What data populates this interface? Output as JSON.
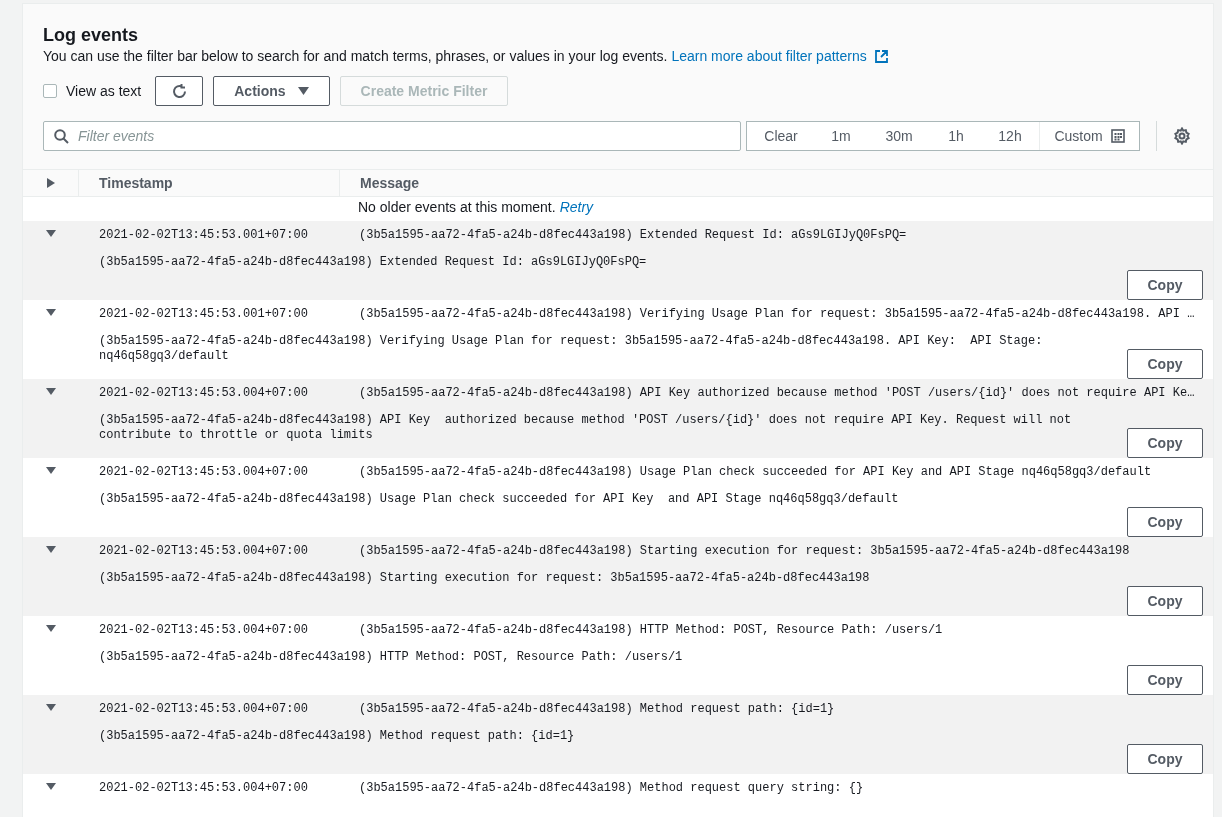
{
  "header": {
    "title": "Log events",
    "description": "You can use the filter bar below to search for and match terms, phrases, or values in your log events.",
    "learn_more_link": "Learn more about filter patterns"
  },
  "toolbar": {
    "view_as_text": {
      "label": "View as text",
      "checked": false
    },
    "actions_button": "Actions",
    "create_metric_filter_button": {
      "label": "Create Metric Filter",
      "disabled": true
    }
  },
  "filter": {
    "placeholder": "Filter events"
  },
  "time_ranges": [
    {
      "label": "Clear",
      "selected": false
    },
    {
      "label": "1m",
      "selected": false
    },
    {
      "label": "30m",
      "selected": false
    },
    {
      "label": "1h",
      "selected": false
    },
    {
      "label": "12h",
      "selected": false
    },
    {
      "label": "Custom",
      "selected": false
    }
  ],
  "table": {
    "columns": [
      "Timestamp",
      "Message"
    ],
    "notice": "No older events at this moment.",
    "retry_link": "Retry",
    "rows": [
      {
        "expanded": true,
        "timestamp": "2021-02-02T13:45:53.001+07:00",
        "message": "(3b5a1595-aa72-4fa5-a24b-d8fec443a198) Extended Request Id: aGs9LGIJyQ0FsPQ=",
        "detail": "(3b5a1595-aa72-4fa5-a24b-d8fec443a198) Extended Request Id: aGs9LGIJyQ0FsPQ=",
        "copy_button": "Copy"
      },
      {
        "expanded": true,
        "timestamp": "2021-02-02T13:45:53.001+07:00",
        "message": "(3b5a1595-aa72-4fa5-a24b-d8fec443a198) Verifying Usage Plan for request: 3b5a1595-aa72-4fa5-a24b-d8fec443a198. API …",
        "detail": "(3b5a1595-aa72-4fa5-a24b-d8fec443a198) Verifying Usage Plan for request: 3b5a1595-aa72-4fa5-a24b-d8fec443a198. API Key:  API Stage: nq46q58gq3/default",
        "copy_button": "Copy"
      },
      {
        "expanded": true,
        "timestamp": "2021-02-02T13:45:53.004+07:00",
        "message": "(3b5a1595-aa72-4fa5-a24b-d8fec443a198) API Key authorized because method 'POST /users/{id}' does not require API Ke…",
        "detail": "(3b5a1595-aa72-4fa5-a24b-d8fec443a198) API Key  authorized because method 'POST /users/{id}' does not require API Key. Request will not contribute to throttle or quota limits",
        "copy_button": "Copy"
      },
      {
        "expanded": true,
        "timestamp": "2021-02-02T13:45:53.004+07:00",
        "message": "(3b5a1595-aa72-4fa5-a24b-d8fec443a198) Usage Plan check succeeded for API Key and API Stage nq46q58gq3/default",
        "detail": "(3b5a1595-aa72-4fa5-a24b-d8fec443a198) Usage Plan check succeeded for API Key  and API Stage nq46q58gq3/default",
        "copy_button": "Copy"
      },
      {
        "expanded": true,
        "timestamp": "2021-02-02T13:45:53.004+07:00",
        "message": "(3b5a1595-aa72-4fa5-a24b-d8fec443a198) Starting execution for request: 3b5a1595-aa72-4fa5-a24b-d8fec443a198",
        "detail": "(3b5a1595-aa72-4fa5-a24b-d8fec443a198) Starting execution for request: 3b5a1595-aa72-4fa5-a24b-d8fec443a198",
        "copy_button": "Copy"
      },
      {
        "expanded": true,
        "timestamp": "2021-02-02T13:45:53.004+07:00",
        "message": "(3b5a1595-aa72-4fa5-a24b-d8fec443a198) HTTP Method: POST, Resource Path: /users/1",
        "detail": "(3b5a1595-aa72-4fa5-a24b-d8fec443a198) HTTP Method: POST, Resource Path: /users/1",
        "copy_button": "Copy"
      },
      {
        "expanded": true,
        "timestamp": "2021-02-02T13:45:53.004+07:00",
        "message": "(3b5a1595-aa72-4fa5-a24b-d8fec443a198) Method request path: {id=1}",
        "detail": "(3b5a1595-aa72-4fa5-a24b-d8fec443a198) Method request path: {id=1}",
        "copy_button": "Copy"
      },
      {
        "expanded": true,
        "timestamp": "2021-02-02T13:45:53.004+07:00",
        "message": "(3b5a1595-aa72-4fa5-a24b-d8fec443a198) Method request query string: {}"
      }
    ]
  }
}
